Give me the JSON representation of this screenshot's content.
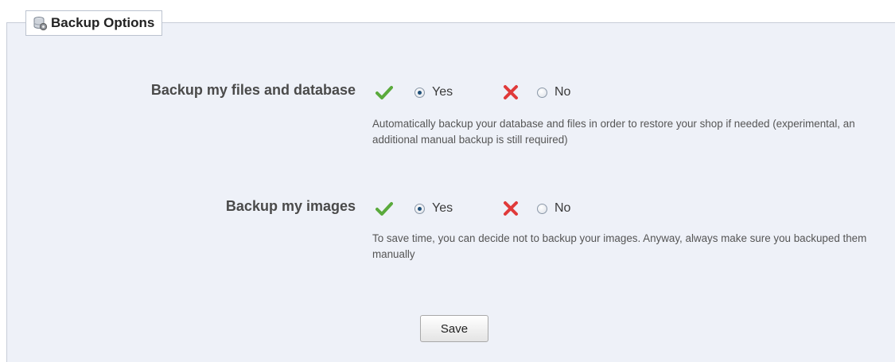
{
  "section": {
    "title": "Backup Options",
    "icon": "database-gear-icon"
  },
  "options": [
    {
      "label": "Backup my files and database",
      "yes_label": "Yes",
      "no_label": "No",
      "selected": "Yes",
      "help": "Automatically backup your database and files in order to restore your shop if needed (experimental, an additional manual backup is still required)"
    },
    {
      "label": "Backup my images",
      "yes_label": "Yes",
      "no_label": "No",
      "selected": "Yes",
      "help": "To save time, you can decide not to backup your images. Anyway, always make sure you backuped them manually"
    }
  ],
  "save_label": "Save",
  "colors": {
    "panel_bg": "#eef1f8",
    "yes_check": "#5aaa3c",
    "no_cross": "#e03a3a"
  }
}
